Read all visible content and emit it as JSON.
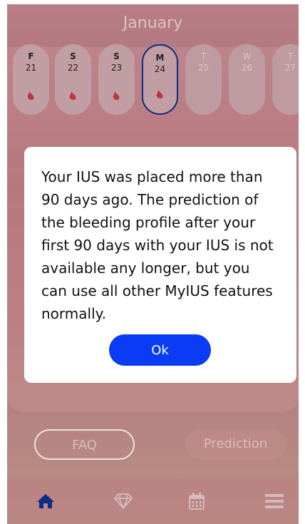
{
  "calendar": {
    "month": "January",
    "days": [
      {
        "weekday": "F",
        "date": "21",
        "bleeding": true,
        "today": false,
        "future": false
      },
      {
        "weekday": "S",
        "date": "22",
        "bleeding": true,
        "today": false,
        "future": false
      },
      {
        "weekday": "S",
        "date": "23",
        "bleeding": true,
        "today": false,
        "future": false
      },
      {
        "weekday": "M",
        "date": "24",
        "bleeding": true,
        "today": true,
        "future": false
      },
      {
        "weekday": "T",
        "date": "25",
        "bleeding": false,
        "today": false,
        "future": true
      },
      {
        "weekday": "W",
        "date": "26",
        "bleeding": false,
        "today": false,
        "future": true
      },
      {
        "weekday": "T",
        "date": "27",
        "bleeding": false,
        "today": false,
        "future": true
      }
    ]
  },
  "buttons": {
    "faq_label": "FAQ",
    "prediction_label": "Prediction"
  },
  "nav": {
    "items": [
      {
        "name": "home-icon",
        "active": true
      },
      {
        "name": "diamond-icon",
        "active": false
      },
      {
        "name": "calendar-icon",
        "active": false
      },
      {
        "name": "menu-icon",
        "active": false
      }
    ]
  },
  "modal": {
    "message": "Your IUS was placed more than 90 days ago. The prediction of the bleeding profile after your first 90 days with your IUS is not available any longer, but you can use all other MyIUS features normally.",
    "ok_label": "Ok"
  },
  "colors": {
    "accent": "#0a3cf5",
    "active_nav": "#0d2c86",
    "bleeding_drop": "#c0323f",
    "inactive_icon": "#d6b9bb"
  }
}
